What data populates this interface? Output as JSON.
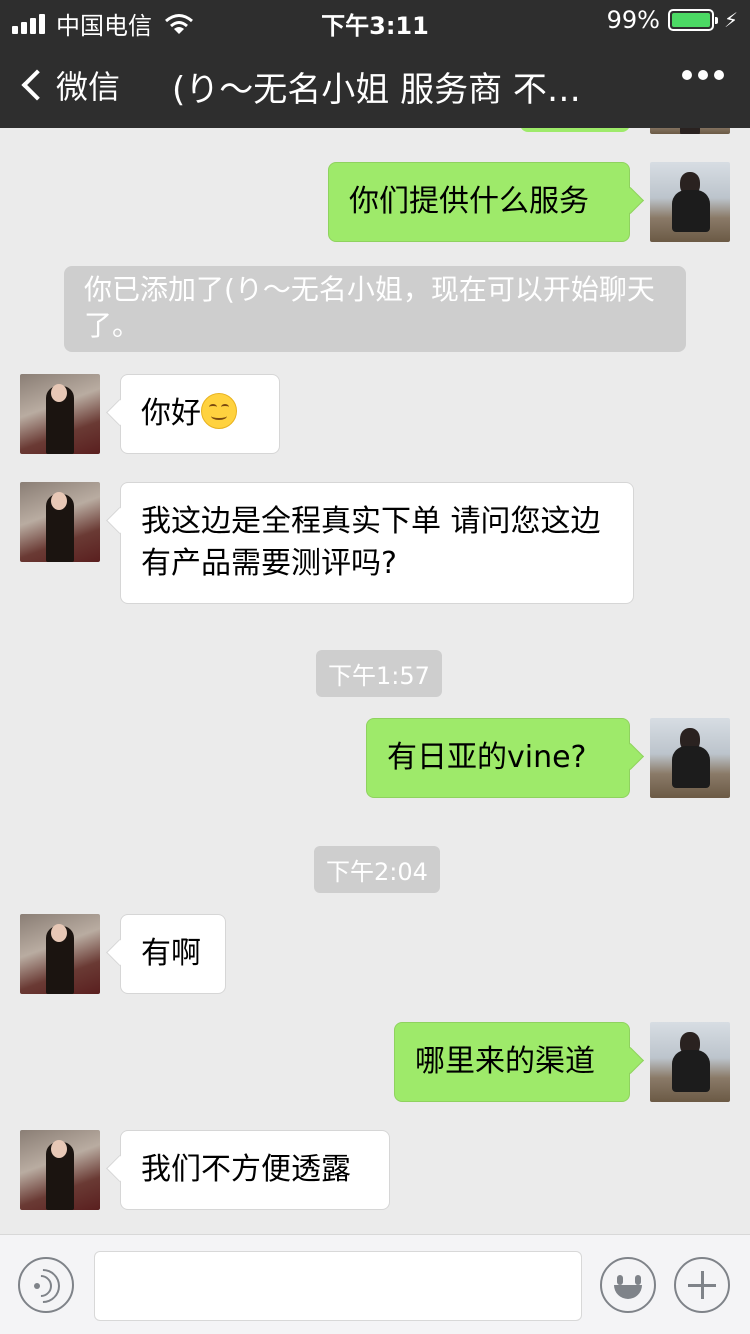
{
  "status_bar": {
    "carrier": "中国电信",
    "time": "下午3:11",
    "battery": "99%",
    "battery_level": 0.99
  },
  "nav": {
    "back_label": "微信",
    "title": "(り～无名小姐 服务商 不…"
  },
  "messages": [
    {
      "from": "me",
      "text": "你们提供什么服务"
    },
    {
      "type": "system",
      "text": "你已添加了(り～无名小姐，现在可以开始聊天了。"
    },
    {
      "from": "other",
      "text": "你好",
      "emoji": "smiling-face-icon"
    },
    {
      "from": "other",
      "text": "我这边是全程真实下单  请问您这边有产品需要测评吗?"
    },
    {
      "type": "time",
      "text": "下午1:57"
    },
    {
      "from": "me",
      "text": "有日亚的vine?"
    },
    {
      "type": "time",
      "text": "下午2:04"
    },
    {
      "from": "other",
      "text": "有啊"
    },
    {
      "from": "me",
      "text": "哪里来的渠道"
    },
    {
      "from": "other",
      "text": "我们不方便透露"
    }
  ],
  "input_bar": {
    "icons": [
      "voice-icon",
      "emoji-icon",
      "plus-icon"
    ]
  },
  "colors": {
    "nav_bg": "#2e2e2e",
    "chat_bg": "#ebebeb",
    "my_bubble": "#9eea6a",
    "other_bubble": "#ffffff"
  }
}
